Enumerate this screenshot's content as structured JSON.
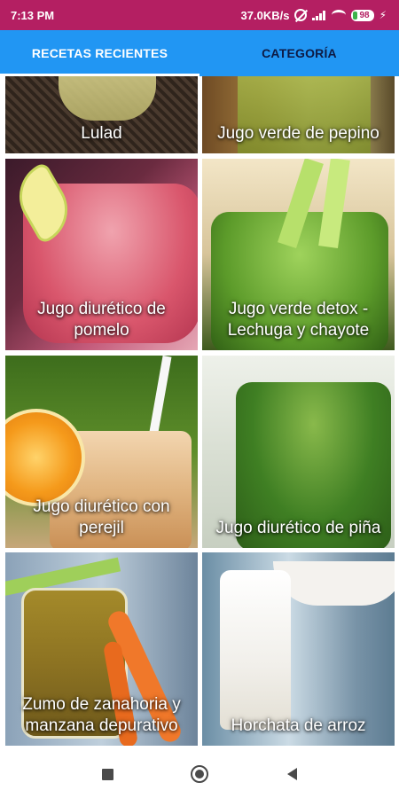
{
  "status_bar": {
    "time": "7:13 PM",
    "network_speed": "37.0KB/s",
    "battery_level": "98",
    "icons": [
      "alarm-off-icon",
      "signal-icon",
      "wifi-icon",
      "battery-icon",
      "charging-icon"
    ],
    "color": "#b41f62"
  },
  "tabs": {
    "items": [
      {
        "label": "RECETAS RECIENTES",
        "active": true
      },
      {
        "label": "CATEGORÍA",
        "active": false
      }
    ],
    "color": "#2196f3"
  },
  "recipes": [
    {
      "title": "Lulad"
    },
    {
      "title": "Jugo verde de pepino"
    },
    {
      "title": "Jugo diurético de pomelo"
    },
    {
      "title": "Jugo verde detox - Lechuga y chayote"
    },
    {
      "title": "Jugo diurético con perejil"
    },
    {
      "title": "Jugo diurético de piña"
    },
    {
      "title": "Zumo de zanahoria y manzana depurativo"
    },
    {
      "title": "Horchata de arroz"
    }
  ],
  "nav_bar": {
    "buttons": [
      "recents-square-icon",
      "home-circle-icon",
      "back-triangle-icon"
    ]
  }
}
